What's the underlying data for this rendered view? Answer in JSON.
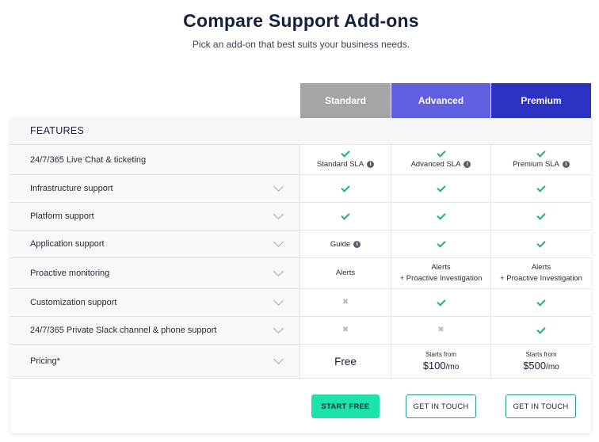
{
  "header": {
    "title": "Compare Support Add-ons",
    "subtitle": "Pick an add-on that best suits your business needs."
  },
  "plans": [
    "Standard",
    "Advanced",
    "Premium"
  ],
  "colors": {
    "standard": "#a5a5a5",
    "advanced": "#5f5fe0",
    "premium": "#2c32c2",
    "check": "#20b46a",
    "cta": "#1de3aa"
  },
  "features_label": "FEATURES",
  "rows": [
    {
      "name": "24/7/365 Live Chat & ticketing",
      "std": "Standard SLA",
      "adv": "Advanced SLA",
      "pre": "Premium SLA"
    },
    {
      "name": "Infrastructure support"
    },
    {
      "name": "Platform support"
    },
    {
      "name": "Application support",
      "std": "Guide"
    },
    {
      "name": "Proactive monitoring",
      "std": "Alerts",
      "adv_line1": "Alerts",
      "adv_line2": "+ Proactive Investigation",
      "pre_line1": "Alerts",
      "pre_line2": "+ Proactive Investigation"
    },
    {
      "name": "Customization support"
    },
    {
      "name": "24/7/365 Private Slack channel & phone support"
    },
    {
      "name": "Pricing*",
      "std": "Free",
      "starts": "Starts from",
      "adv_price": "$100",
      "pre_price": "$500",
      "per": "/mo"
    }
  ],
  "icons": {
    "check": "check-icon",
    "cross": "cross-icon",
    "info": "info-icon",
    "chevron": "chevron-down-icon"
  },
  "buttons": {
    "start_free": "START FREE",
    "get_in_touch": "GET IN TOUCH"
  }
}
